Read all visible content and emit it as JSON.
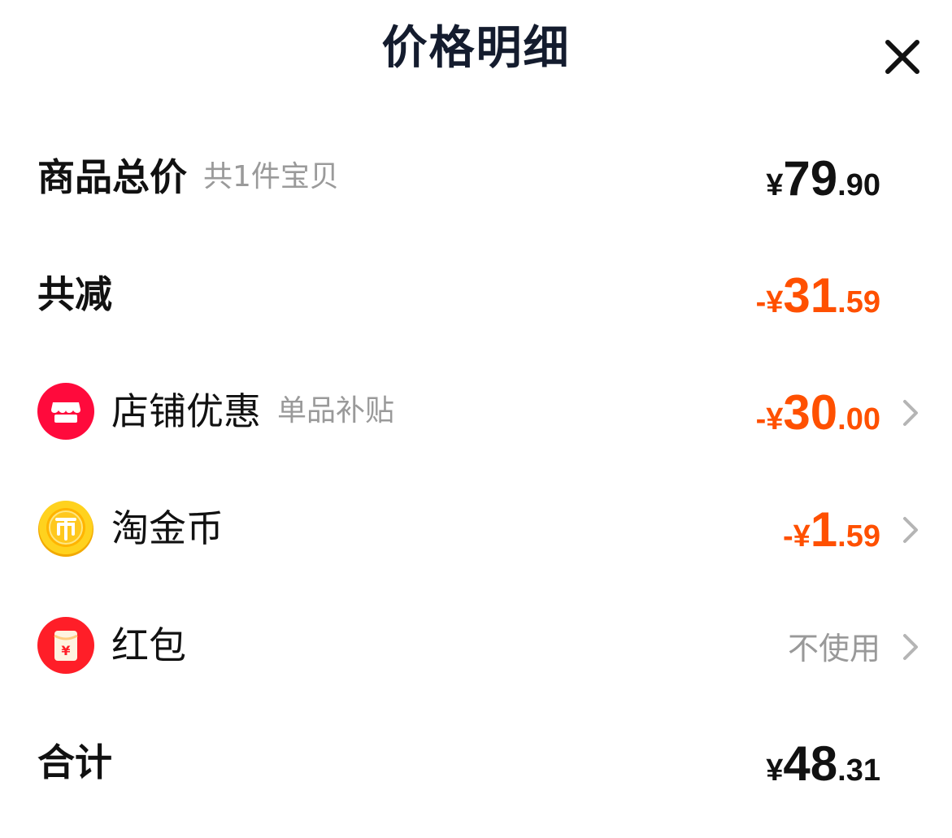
{
  "header": {
    "title": "价格明细"
  },
  "rows": {
    "subtotal": {
      "label": "商品总价",
      "sub": "共1件宝贝",
      "prefix": "¥",
      "int": "79",
      "dec": ".90"
    },
    "total_discount": {
      "label": "共减",
      "prefix": "-¥",
      "int": "31",
      "dec": ".59"
    },
    "shop_discount": {
      "label": "店铺优惠",
      "sub": "单品补贴",
      "prefix": "-¥",
      "int": "30",
      "dec": ".00",
      "icon": "store-icon"
    },
    "coins": {
      "label": "淘金币",
      "prefix": "-¥",
      "int": "1",
      "dec": ".59",
      "icon": "gold-coin-icon"
    },
    "red_packet": {
      "label": "红包",
      "status": "不使用",
      "icon": "red-packet-icon",
      "icon_symbol": "¥"
    },
    "total": {
      "label": "合计",
      "prefix": "¥",
      "int": "48",
      "dec": ".31"
    }
  },
  "colors": {
    "accent": "#ff5000",
    "title": "#141c2e",
    "muted": "#999999",
    "shop_icon_bg": "#ff0a3c",
    "coin_gold": "#ffcc1a",
    "red_packet_bg": "#ff1e28"
  }
}
